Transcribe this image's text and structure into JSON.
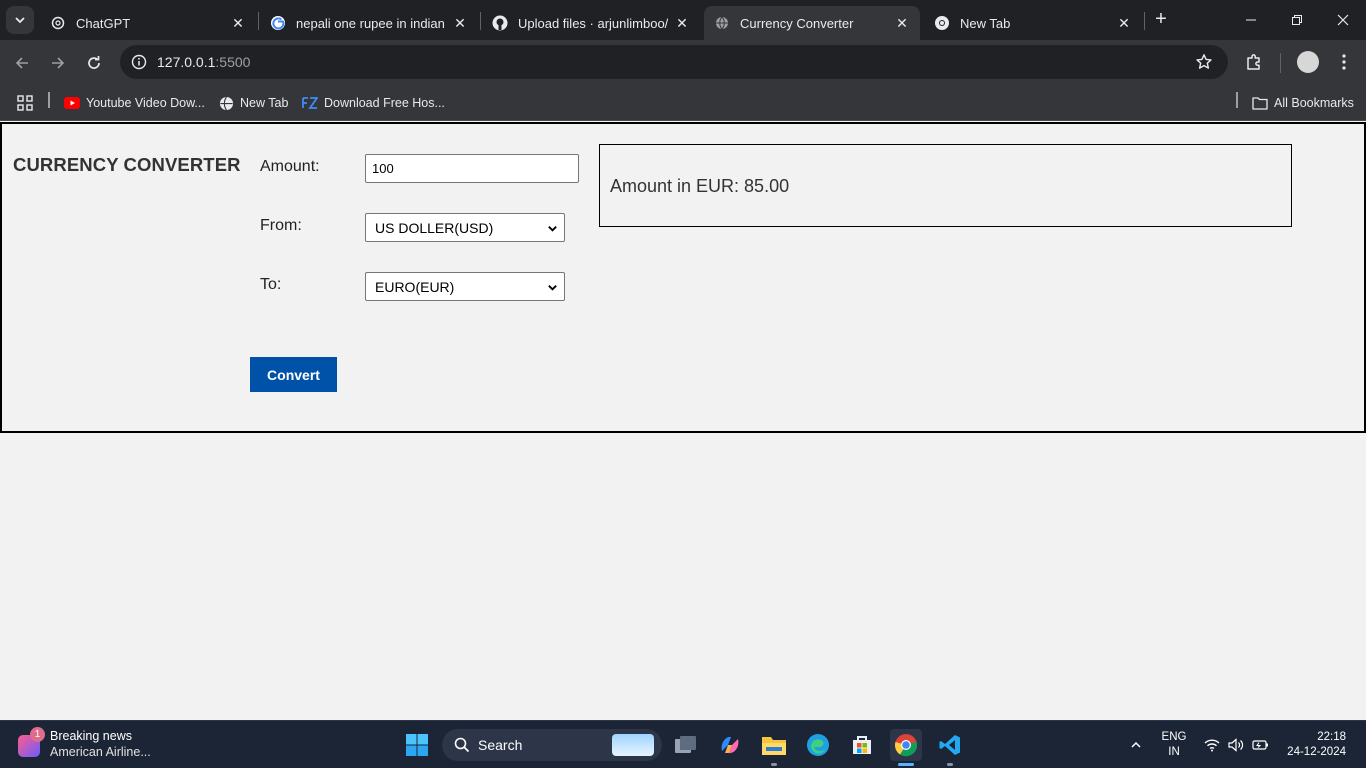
{
  "browser": {
    "tabs": [
      {
        "title": "ChatGPT",
        "icon": "chatgpt-icon",
        "active": false
      },
      {
        "title": "nepali one rupee in indian va",
        "icon": "google-icon",
        "active": false
      },
      {
        "title": "Upload files · arjunlimboo/C",
        "icon": "github-icon",
        "active": false
      },
      {
        "title": "Currency Converter",
        "icon": "globe-icon",
        "active": true
      },
      {
        "title": "New Tab",
        "icon": "chrome-icon",
        "active": false
      }
    ],
    "address": {
      "host": "127.0.0.1",
      "port": ":5500"
    },
    "bookmarks": [
      {
        "label": "Youtube Video Dow...",
        "icon": "youtube-icon"
      },
      {
        "label": "New Tab",
        "icon": "globe-icon"
      },
      {
        "label": "Download Free Hos...",
        "icon": "fz-icon"
      }
    ],
    "all_bookmarks_label": "All Bookmarks"
  },
  "app": {
    "title": "CURRENCY CONVERTER",
    "amount_label": "Amount:",
    "amount_value": "100",
    "from_label": "From:",
    "from_value": "US DOLLER(USD)",
    "to_label": "To:",
    "to_value": "EURO(EUR)",
    "convert_label": "Convert",
    "result_text": "Amount in EUR: 85.00"
  },
  "taskbar": {
    "news_badge": "1",
    "news_title": "Breaking news",
    "news_subtitle": "American Airline...",
    "search_label": "Search",
    "language_line1": "ENG",
    "language_line2": "IN",
    "time": "22:18",
    "date": "24-12-2024"
  },
  "colors": {
    "accent_button": "#0052a8",
    "page_background": "#f2f2f2",
    "chrome_dark": "#202124",
    "chrome_toolbar": "#35363a",
    "taskbar": "#1c2536"
  }
}
